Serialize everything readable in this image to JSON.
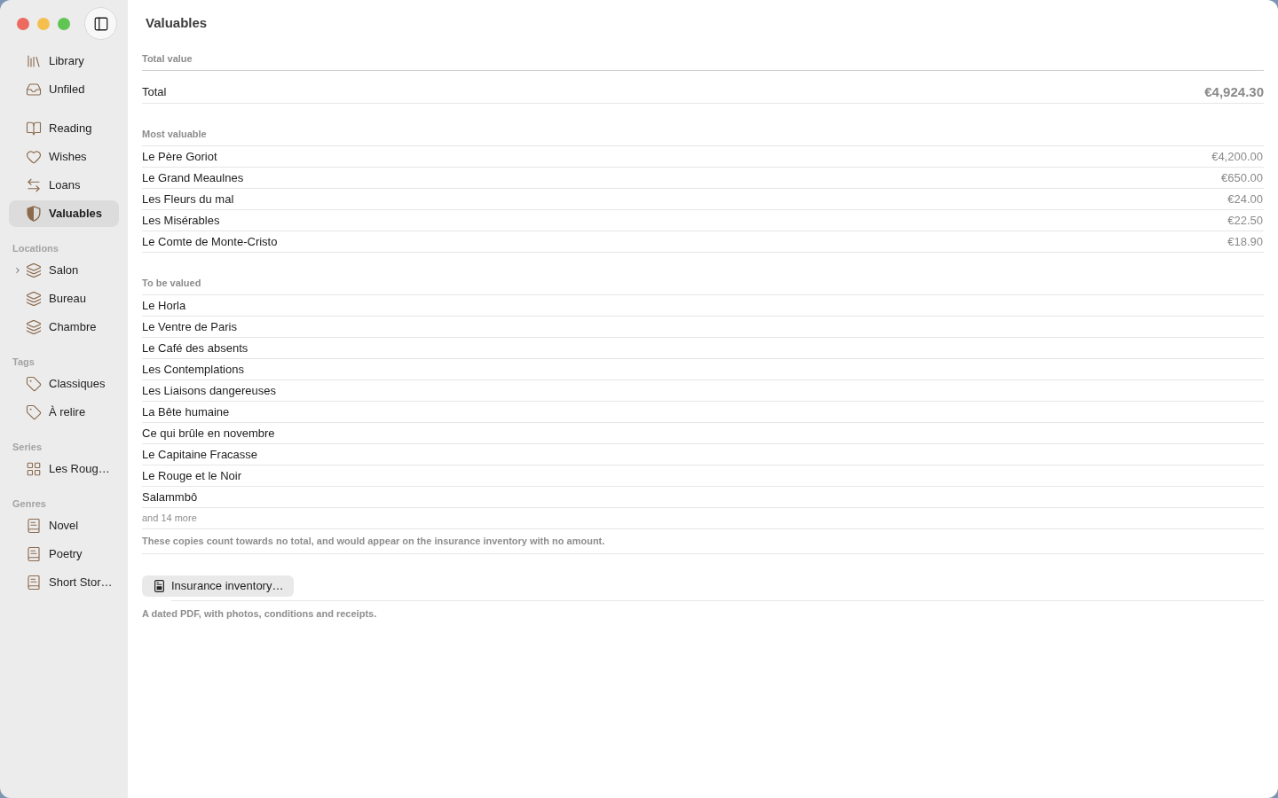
{
  "window": {
    "title": "Valuables"
  },
  "sidebar": {
    "groups": [
      {
        "items": [
          {
            "label": "Library",
            "selected": false
          },
          {
            "label": "Unfiled",
            "selected": false
          }
        ]
      },
      {
        "items": [
          {
            "label": "Reading",
            "selected": false
          },
          {
            "label": "Wishes",
            "selected": false
          },
          {
            "label": "Loans",
            "selected": false
          },
          {
            "label": "Valuables",
            "selected": true
          }
        ]
      },
      {
        "title": "Locations",
        "items": [
          {
            "label": "Salon",
            "selected": false,
            "expanded": false
          },
          {
            "label": "Bureau",
            "selected": false
          },
          {
            "label": "Chambre",
            "selected": false
          }
        ]
      },
      {
        "title": "Tags",
        "items": [
          {
            "label": "Classiques",
            "selected": false
          },
          {
            "label": "À relire",
            "selected": false
          }
        ]
      },
      {
        "title": "Series",
        "items": [
          {
            "label": "Les Roug…",
            "selected": false
          }
        ]
      },
      {
        "title": "Genres",
        "items": [
          {
            "label": "Novel",
            "selected": false
          },
          {
            "label": "Poetry",
            "selected": false
          },
          {
            "label": "Short Stor…",
            "selected": false
          }
        ]
      }
    ]
  },
  "sections": [
    {
      "kind": "total",
      "header": "Total value",
      "rows": [
        {
          "title": "Total",
          "value": "€4,924.30"
        }
      ]
    },
    {
      "kind": "list",
      "header": "Most valuable",
      "rows": [
        {
          "title": "Le Père Goriot",
          "value": "€4,200.00"
        },
        {
          "title": "Le Grand Meaulnes",
          "value": "€650.00"
        },
        {
          "title": "Les Fleurs du mal",
          "value": "€24.00"
        },
        {
          "title": "Les Misérables",
          "value": "€22.50"
        },
        {
          "title": "Le Comte de Monte-Cristo",
          "value": "€18.90"
        }
      ]
    },
    {
      "kind": "list",
      "header": "To be valued",
      "rows": [
        {
          "title": "Le Horla"
        },
        {
          "title": "Le Ventre de Paris"
        },
        {
          "title": "Le Café des absents"
        },
        {
          "title": "Les Contemplations"
        },
        {
          "title": "Les Liaisons dangereuses"
        },
        {
          "title": "La Bête humaine"
        },
        {
          "title": "Ce qui brûle en novembre"
        },
        {
          "title": "Le Capitaine Fracasse"
        },
        {
          "title": "Le Rouge et le Noir"
        },
        {
          "title": "Salammbô"
        }
      ],
      "more": "and 14 more",
      "note": "These copies count towards no total, and would appear on the insurance inventory with no amount."
    }
  ],
  "action": {
    "button": "Insurance inventory…",
    "caption": "A dated PDF, with photos, conditions and receipts."
  }
}
